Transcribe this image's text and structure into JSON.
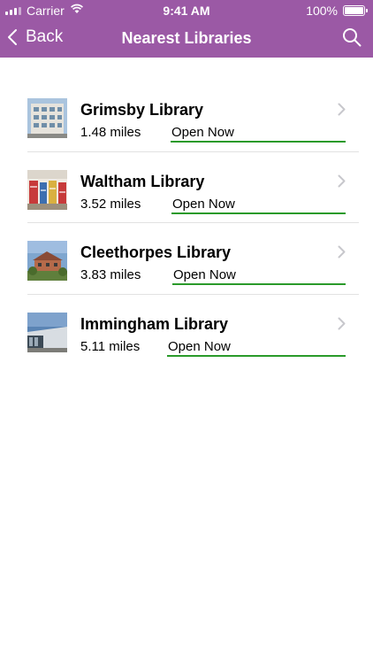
{
  "status_bar": {
    "carrier": "Carrier",
    "time": "9:41 AM",
    "battery": "100%"
  },
  "nav": {
    "back_label": "Back",
    "title": "Nearest Libraries",
    "search_icon": "search-icon"
  },
  "colors": {
    "header": "#9b59a5",
    "open_underline": "#2a9a2a",
    "chevron": "#c7c7cc"
  },
  "libraries": [
    {
      "name": "Grimsby Library",
      "distance": "1.48 miles",
      "status": "Open Now"
    },
    {
      "name": "Waltham Library",
      "distance": "3.52 miles",
      "status": "Open Now"
    },
    {
      "name": "Cleethorpes Library",
      "distance": "3.83 miles",
      "status": "Open Now"
    },
    {
      "name": "Immingham Library",
      "distance": "5.11 miles",
      "status": "Open Now"
    }
  ]
}
